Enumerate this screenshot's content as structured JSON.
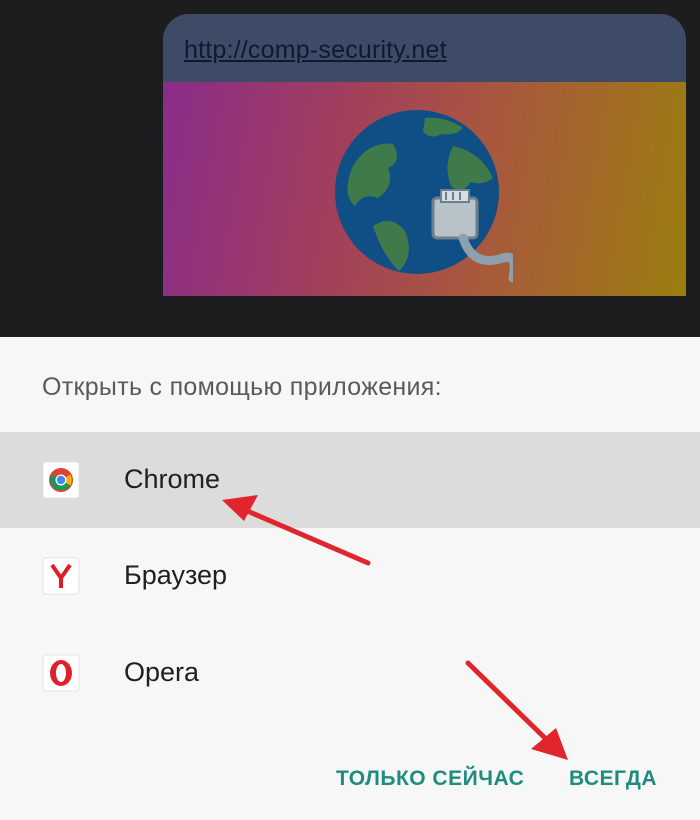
{
  "chat": {
    "link_text": "http://comp-security.net"
  },
  "dialog": {
    "title": "Открыть с помощью приложения:",
    "apps": [
      {
        "label": "Chrome",
        "icon": "chrome-icon",
        "selected": true
      },
      {
        "label": "Браузер",
        "icon": "yandex-browser-icon",
        "selected": false
      },
      {
        "label": "Opera",
        "icon": "opera-icon",
        "selected": false
      }
    ],
    "buttons": {
      "just_once": "ТОЛЬКО СЕЙЧАС",
      "always": "ВСЕГДА"
    }
  },
  "colors": {
    "accent": "#1f8c81",
    "annotation_arrow": "#e0262c",
    "selected_row": "#dcdcdc"
  }
}
